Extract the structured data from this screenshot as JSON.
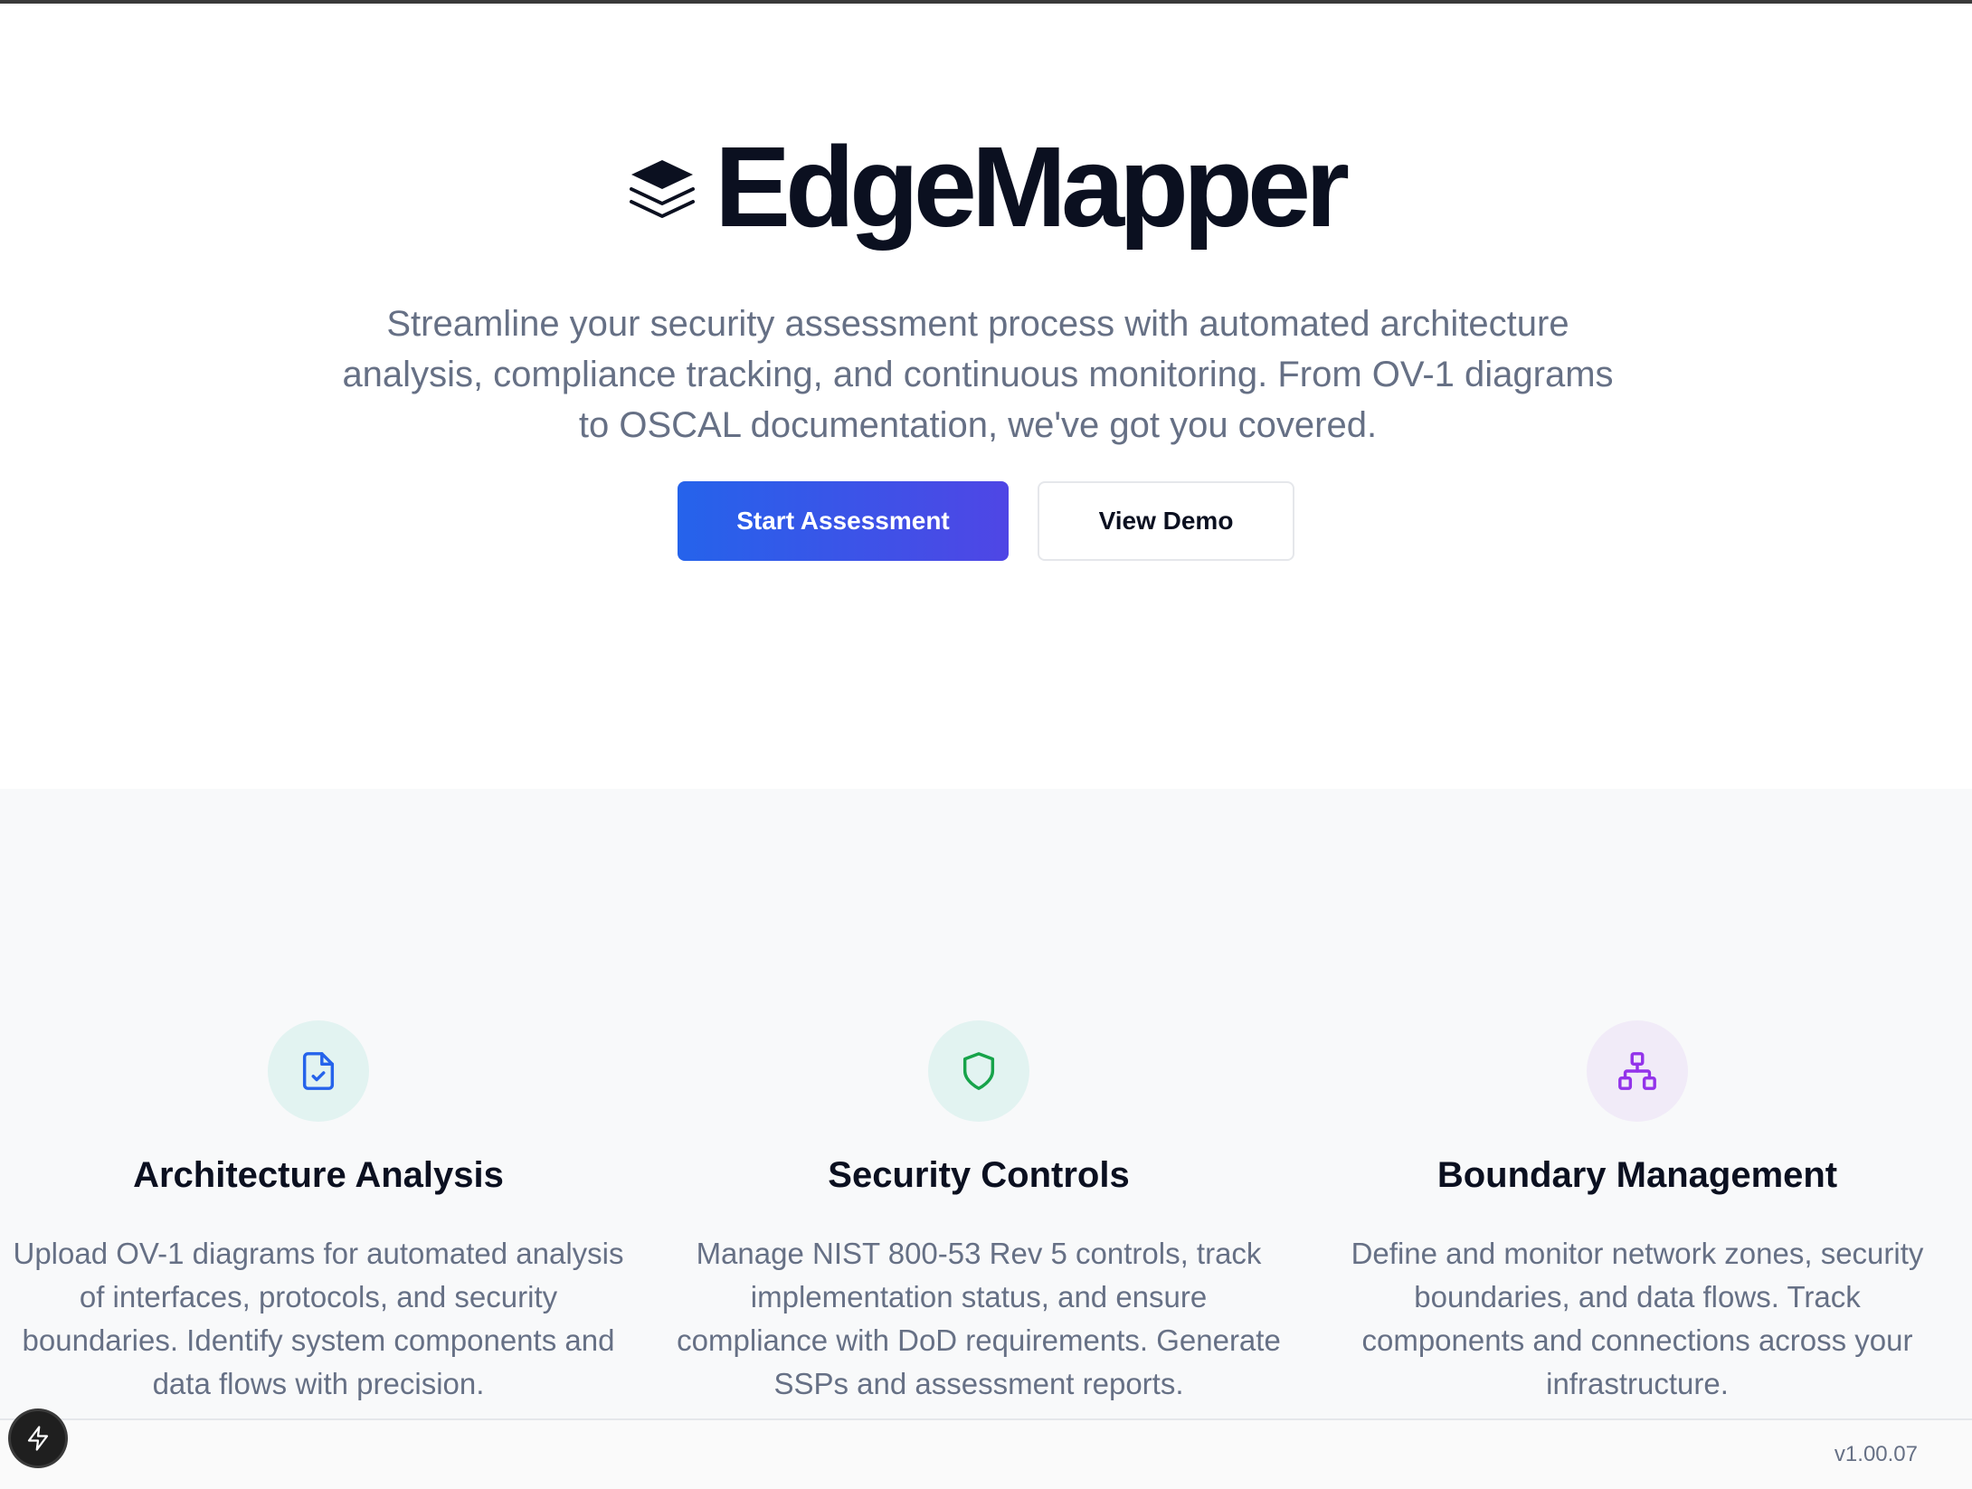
{
  "brand": {
    "name": "EdgeMapper",
    "logo_icon": "layers-icon"
  },
  "hero": {
    "subtitle": "Streamline your security assessment process with automated architecture analysis, compliance tracking, and continuous monitoring. From OV-1 diagrams to OSCAL documentation, we've got you covered.",
    "primary_cta": "Start Assessment",
    "secondary_cta": "View Demo"
  },
  "features": [
    {
      "icon": "file-check-icon",
      "title": "Architecture Analysis",
      "description": "Upload OV-1 diagrams for automated analysis of interfaces, protocols, and security boundaries. Identify system components and data flows with precision.",
      "accent": "#2563eb",
      "icon_bg": "#e2f3f1"
    },
    {
      "icon": "shield-icon",
      "title": "Security Controls",
      "description": "Manage NIST 800-53 Rev 5 controls, track implementation status, and ensure compliance with DoD requirements. Generate SSPs and assessment reports.",
      "accent": "#16a34a",
      "icon_bg": "#e2f3f1"
    },
    {
      "icon": "network-icon",
      "title": "Boundary Management",
      "description": "Define and monitor network zones, security boundaries, and data flows. Track components and connections across your infrastructure.",
      "accent": "#9333ea",
      "icon_bg": "#f1ebf8"
    }
  ],
  "footer": {
    "version": "v1.00.07",
    "fab_icon": "lightning-icon"
  },
  "colors": {
    "primary_gradient_start": "#2563eb",
    "primary_gradient_end": "#4f46e5",
    "text_dark": "#0b1020",
    "text_muted": "#667085"
  }
}
